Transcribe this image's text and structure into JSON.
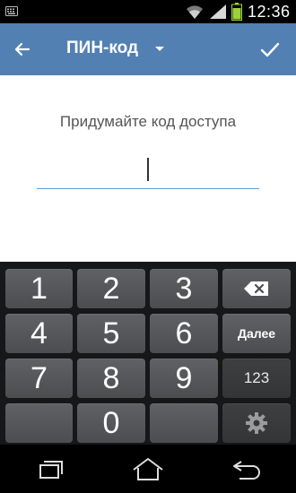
{
  "status_bar": {
    "time": "12:36",
    "icons": [
      "keyboard-icon",
      "wifi-icon",
      "signal-icon",
      "battery-icon"
    ]
  },
  "action_bar": {
    "title": "ПИН-код",
    "background": "#5280b2"
  },
  "content": {
    "prompt": "Придумайте код доступа",
    "input_value": "",
    "accent": "#5d9cdb"
  },
  "keypad": {
    "row1": [
      "1",
      "2",
      "3"
    ],
    "row2": [
      "4",
      "5",
      "6"
    ],
    "row3": [
      "7",
      "8",
      "9"
    ],
    "row4_center": "0",
    "next_label": "Далее",
    "mode_label": "123",
    "special_icons": [
      "backspace-icon",
      "settings-gear-icon"
    ]
  },
  "nav_bar": {
    "buttons": [
      "recent-apps-icon",
      "home-icon",
      "back-nav-icon"
    ]
  }
}
